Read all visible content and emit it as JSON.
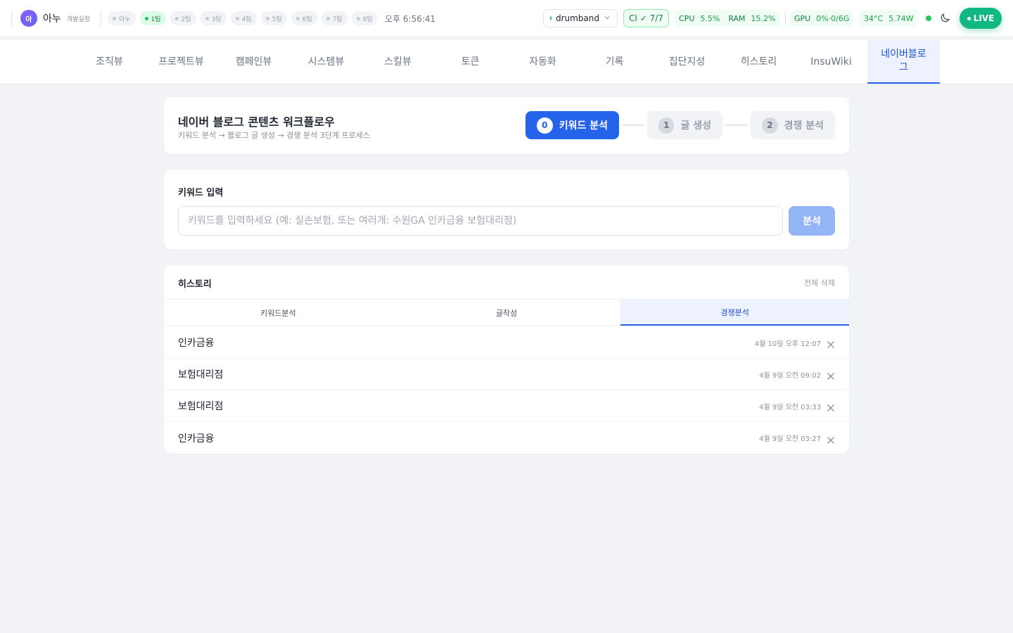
{
  "user": {
    "avatar": "아",
    "name": "아누",
    "role": "개발실장"
  },
  "teams": [
    {
      "label": "아누",
      "active": false
    },
    {
      "label": "1팀",
      "active": true
    },
    {
      "label": "2팀",
      "active": false
    },
    {
      "label": "3팀",
      "active": false
    },
    {
      "label": "4팀",
      "active": false
    },
    {
      "label": "5팀",
      "active": false
    },
    {
      "label": "6팀",
      "active": false
    },
    {
      "label": "7팀",
      "active": false
    },
    {
      "label": "8팀",
      "active": false
    }
  ],
  "clock": "오후 6:56:41",
  "repo": {
    "label": "drumband"
  },
  "ci": {
    "label": "CI ✓ 7/7"
  },
  "metrics": {
    "cpu": {
      "label": "CPU",
      "value": "5.5%"
    },
    "ram": {
      "label": "RAM",
      "value": "15.2%"
    },
    "gpu": {
      "label": "GPU",
      "value": "0%·0/6G"
    },
    "temp": "34°C",
    "power": "5.74W"
  },
  "live": {
    "label": "LIVE"
  },
  "nav": {
    "tabs": [
      "조직뷰",
      "프로젝트뷰",
      "캠페인뷰",
      "시스템뷰",
      "스킬뷰",
      "토큰",
      "자동화",
      "기록",
      "집단지성",
      "히스토리",
      "InsuWiki",
      "네이버블로그"
    ],
    "active_index": 11
  },
  "workflow": {
    "title": "네이버 블로그 콘텐츠 워크플로우",
    "subtitle": "키워드 분석 → 블로그 글 생성 → 경쟁 분석 3단계 프로세스",
    "steps": [
      {
        "num": "0",
        "label": "키워드 분석",
        "active": true
      },
      {
        "num": "1",
        "label": "글 생성",
        "active": false
      },
      {
        "num": "2",
        "label": "경쟁 분석",
        "active": false
      }
    ]
  },
  "keyword": {
    "label": "키워드 입력",
    "placeholder": "키워드를 입력하세요 (예: 실손보험, 또는 여러개: 수원GA 인카금융 보험대리점)",
    "value": "",
    "button": "분석"
  },
  "history": {
    "title": "히스토리",
    "clear_all": "전체 삭제",
    "tabs": [
      "키워드분석",
      "글작성",
      "경쟁분석"
    ],
    "active_tab": 2,
    "items": [
      {
        "keyword": "인카금융",
        "time": "4월 10일 오후 12:07"
      },
      {
        "keyword": "보험대리점",
        "time": "4월 9일 오전 09:02"
      },
      {
        "keyword": "보험대리점",
        "time": "4월 9일 오전 03:33"
      },
      {
        "keyword": "인카금융",
        "time": "4월 9일 오전 03:27"
      }
    ]
  },
  "colors": {
    "accent": "#2563eb",
    "live": "#10b981",
    "ok": "#16a34a",
    "background": "#f1f3f7"
  }
}
